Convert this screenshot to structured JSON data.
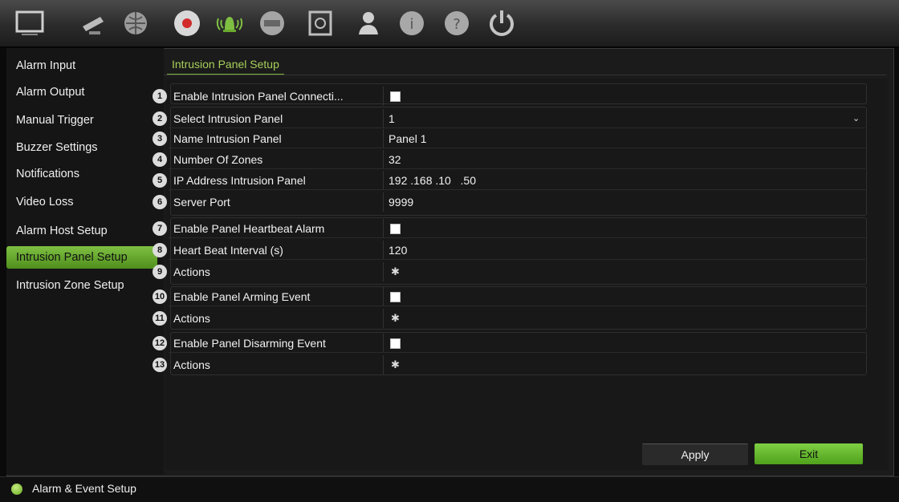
{
  "toolbar": {
    "icons": [
      "monitor-icon",
      "camera-icon",
      "network-icon",
      "record-icon",
      "alarm-icon",
      "hdd-icon",
      "storage-icon",
      "user-icon",
      "info-icon",
      "help-icon",
      "power-icon"
    ],
    "active_icon": "alarm-icon"
  },
  "sidebar": {
    "items": [
      {
        "label": "Alarm Input"
      },
      {
        "label": "Alarm Output"
      },
      {
        "label": "Manual Trigger"
      },
      {
        "label": "Buzzer Settings"
      },
      {
        "label": "Notifications"
      },
      {
        "label": "Video Loss"
      },
      {
        "label": "Alarm Host Setup"
      },
      {
        "label": "Intrusion Panel Setup"
      },
      {
        "label": "Intrusion Zone Setup"
      }
    ],
    "active_index": 7
  },
  "tab": {
    "title": "Intrusion Panel Setup"
  },
  "rows": [
    {
      "num": "1",
      "label": "Enable Intrusion Panel Connecti...",
      "type": "checkbox"
    },
    {
      "num": "2",
      "label": "Select Intrusion Panel",
      "type": "select",
      "value": "1"
    },
    {
      "num": "3",
      "label": "Name Intrusion Panel",
      "type": "text",
      "value": "Panel 1"
    },
    {
      "num": "4",
      "label": "Number Of Zones",
      "type": "text",
      "value": "32"
    },
    {
      "num": "5",
      "label": "IP Address Intrusion Panel",
      "type": "text",
      "value": "192 .168 .10   .50"
    },
    {
      "num": "6",
      "label": "Server Port",
      "type": "text",
      "value": "9999"
    },
    {
      "num": "7",
      "label": "Enable Panel Heartbeat Alarm",
      "type": "checkbox"
    },
    {
      "num": "8",
      "label": "Heart Beat Interval (s)",
      "type": "text",
      "value": "120"
    },
    {
      "num": "9",
      "label": "Actions",
      "type": "gear"
    },
    {
      "num": "10",
      "label": "Enable Panel Arming Event",
      "type": "checkbox"
    },
    {
      "num": "11",
      "label": "Actions",
      "type": "gear"
    },
    {
      "num": "12",
      "label": "Enable Panel Disarming Event",
      "type": "checkbox"
    },
    {
      "num": "13",
      "label": "Actions",
      "type": "gear"
    }
  ],
  "buttons": {
    "apply": "Apply",
    "exit": "Exit"
  },
  "status": {
    "text": "Alarm & Event Setup"
  },
  "colors": {
    "accent": "#7fc043",
    "title": "#a6cf5a"
  }
}
